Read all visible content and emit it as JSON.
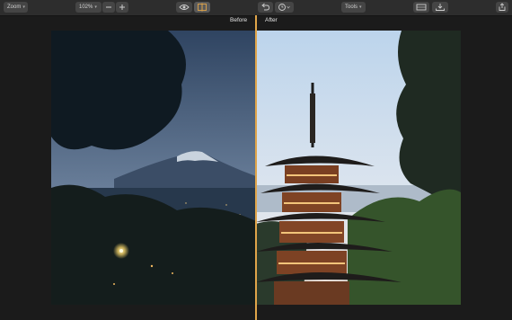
{
  "toolbar": {
    "zoom_menu": {
      "label": "Zoom",
      "icon": "chevron-down-icon"
    },
    "zoom_level": {
      "value": "102%",
      "icon": "chevron-down-icon"
    },
    "zoom_out_icon": "minus-icon",
    "zoom_in_icon": "plus-icon",
    "view_icon": "eye-icon",
    "compare_icon": "split-view-icon",
    "undo_icon": "undo-icon",
    "history_icon": "clock-icon",
    "tools_menu": {
      "label": "Tools",
      "icon": "chevron-down-icon"
    },
    "aspect_icon": "aspect-ratio-icon",
    "export_icon": "export-icon",
    "share_icon": "share-icon"
  },
  "compare": {
    "before_label": "Before",
    "after_label": "After",
    "divider_color": "#e0a54a"
  },
  "colors": {
    "toolbar_bg": "#2d2d2d",
    "app_bg": "#1b1b1b",
    "button_bg": "#454545"
  }
}
